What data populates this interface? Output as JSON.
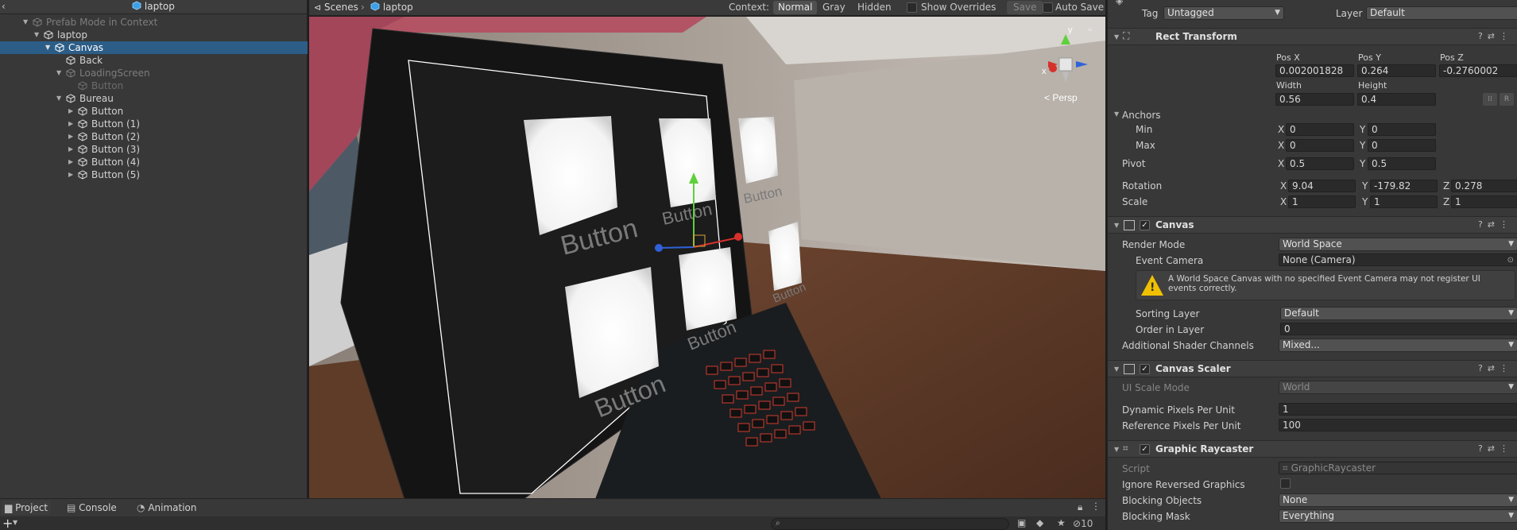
{
  "hierarchy": {
    "back_glyph": "‹",
    "title": "laptop",
    "items": [
      {
        "label": "Prefab Mode in Context"
      },
      {
        "label": "laptop"
      },
      {
        "label": "Canvas"
      },
      {
        "label": "Back"
      },
      {
        "label": "LoadingScreen"
      },
      {
        "label": "Button"
      },
      {
        "label": "Bureau"
      },
      {
        "label": "Button"
      },
      {
        "label": "Button (1)"
      },
      {
        "label": "Button (2)"
      },
      {
        "label": "Button (3)"
      },
      {
        "label": "Button (4)"
      },
      {
        "label": "Button (5)"
      }
    ]
  },
  "scene_bar": {
    "scenes_label": "Scenes",
    "separator": "›",
    "prefab_label": "laptop",
    "context_label": "Context:",
    "mode_normal": "Normal",
    "mode_gray": "Gray",
    "mode_hidden": "Hidden",
    "show_overrides": "Show Overrides",
    "save": "Save",
    "auto_save": "Auto Save"
  },
  "viewport": {
    "gizmo": {
      "y": "y",
      "x": "x",
      "persp": "< Persp"
    },
    "screen_buttons": [
      "Button",
      "Button",
      "Button",
      "Button",
      "Button",
      "Button"
    ]
  },
  "bottom": {
    "tabs": [
      "Project",
      "Console",
      "Animation"
    ],
    "add": "+",
    "hidden_count": "10"
  },
  "inspector": {
    "tag_label": "Tag",
    "tag_value": "Untagged",
    "layer_label": "Layer",
    "layer_value": "Default",
    "rect_transform": {
      "title": "Rect Transform",
      "pos_x_label": "Pos X",
      "pos_y_label": "Pos Y",
      "pos_z_label": "Pos Z",
      "pos_x": "0.002001828",
      "pos_y": "0.264",
      "pos_z": "-0.2760002",
      "width_label": "Width",
      "height_label": "Height",
      "width": "0.56",
      "height": "0.4",
      "anchors_label": "Anchors",
      "min_label": "Min",
      "max_label": "Max",
      "min_x": "0",
      "min_y": "0",
      "max_x": "0",
      "max_y": "0",
      "pivot_label": "Pivot",
      "pivot_x": "0.5",
      "pivot_y": "0.5",
      "rotation_label": "Rotation",
      "rot_x": "9.04",
      "rot_y": "-179.82",
      "rot_z": "0.278",
      "scale_label": "Scale",
      "scale_x": "1",
      "scale_y": "1",
      "scale_z": "1",
      "axis_x": "X",
      "axis_y": "Y",
      "axis_z": "Z",
      "r_button": "R"
    },
    "canvas": {
      "title": "Canvas",
      "render_mode_label": "Render Mode",
      "render_mode": "World Space",
      "event_camera_label": "Event Camera",
      "event_camera": "None (Camera)",
      "warning": "A World Space Canvas with no specified Event Camera may not register UI events correctly.",
      "sorting_layer_label": "Sorting Layer",
      "sorting_layer": "Default",
      "order_label": "Order in Layer",
      "order": "0",
      "shader_label": "Additional Shader Channels",
      "shader": "Mixed..."
    },
    "canvas_scaler": {
      "title": "Canvas Scaler",
      "scale_mode_label": "UI Scale Mode",
      "scale_mode": "World",
      "dyn_label": "Dynamic Pixels Per Unit",
      "dyn": "1",
      "ref_label": "Reference Pixels Per Unit",
      "ref": "100"
    },
    "raycaster": {
      "title": "Graphic Raycaster",
      "script_label": "Script",
      "script": "GraphicRaycaster",
      "ignore_label": "Ignore Reversed Graphics",
      "blocking_objects_label": "Blocking Objects",
      "blocking_objects": "None",
      "blocking_mask_label": "Blocking Mask",
      "blocking_mask": "Everything"
    }
  }
}
